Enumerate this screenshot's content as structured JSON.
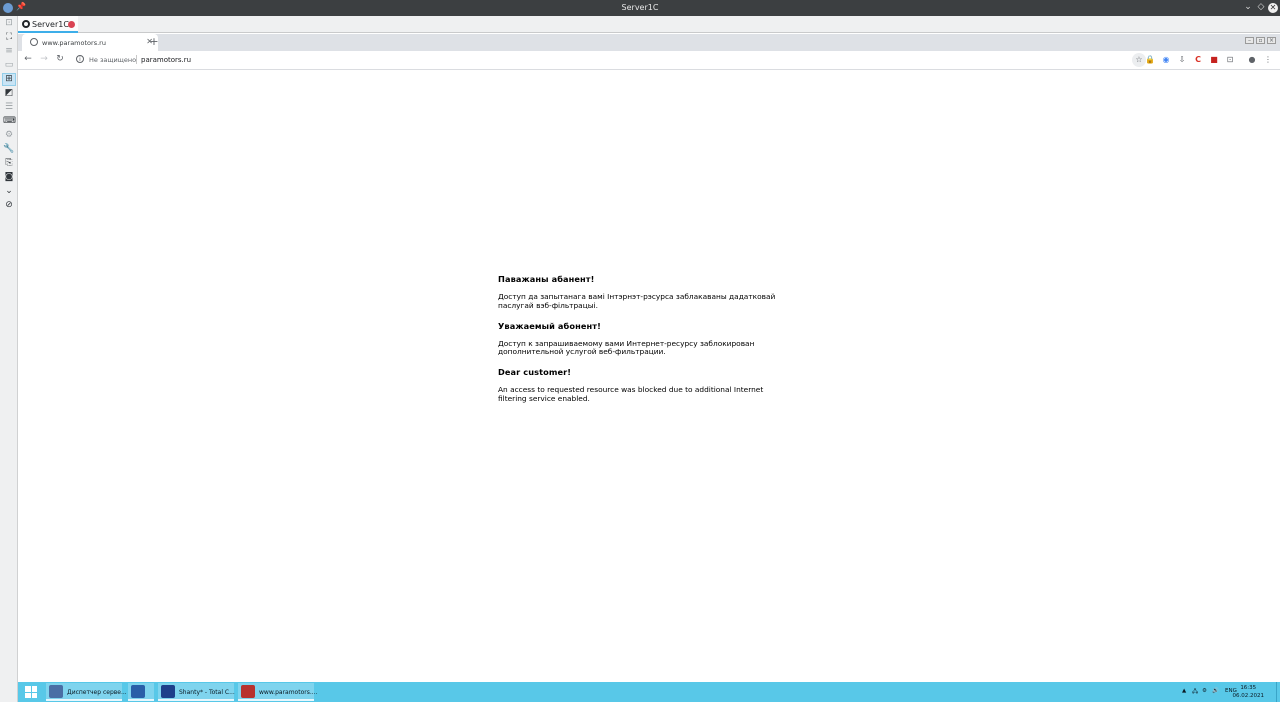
{
  "remote_window": {
    "title": "Server1C",
    "session_tab": {
      "label": "Server1C"
    }
  },
  "left_toolbar": {
    "tools": [
      {
        "icon": "fit-screen-icon",
        "glyph": "⊡",
        "state": "dim"
      },
      {
        "icon": "fullscreen-icon",
        "glyph": "⛶",
        "state": "normal"
      },
      {
        "icon": "menu-icon",
        "glyph": "≡",
        "state": "dim"
      },
      {
        "icon": "window-icon",
        "glyph": "▭",
        "state": "dim"
      },
      {
        "icon": "scale-icon",
        "glyph": "⊞",
        "state": "active"
      },
      {
        "icon": "grab-input-icon",
        "glyph": "◩",
        "state": "normal"
      },
      {
        "icon": "list-icon",
        "glyph": "☰",
        "state": "dim"
      },
      {
        "icon": "keyboard-icon",
        "glyph": "⌨",
        "state": "normal"
      },
      {
        "icon": "settings-icon",
        "glyph": "⚙",
        "state": "dim"
      },
      {
        "icon": "wrench-icon",
        "glyph": "🔧",
        "state": "normal"
      },
      {
        "icon": "clipboard-icon",
        "glyph": "⎘",
        "state": "normal"
      },
      {
        "icon": "screenshot-icon",
        "glyph": "◙",
        "state": "normal"
      },
      {
        "icon": "collapse-icon",
        "glyph": "⌄",
        "state": "normal"
      },
      {
        "icon": "disconnect-icon",
        "glyph": "⊘",
        "state": "normal"
      }
    ]
  },
  "browser": {
    "tab": {
      "title": "www.paramotors.ru"
    },
    "omnibox": {
      "security_label": "Не защищено",
      "url": "paramotors.ru"
    }
  },
  "page": {
    "sections": [
      {
        "heading": "Паважаны абанент!",
        "lines": [
          "Доступ да запытанага вамі Інтэрнэт-рэсурса заблакаваны дадатковай",
          "паслугай вэб-фільтрацыі."
        ]
      },
      {
        "heading": "Уважаемый абонент!",
        "lines": [
          "Доступ к запрашиваемому вами Интернет-ресурсу заблокирован",
          "дополнительной услугой веб-фильтрации."
        ]
      },
      {
        "heading": "Dear customer!",
        "lines": [
          "An access to requested resource was blocked due to additional Internet",
          "filtering service enabled."
        ]
      }
    ]
  },
  "taskbar": {
    "tasks": [
      {
        "label": "Диспетчер серве...",
        "icon": "server-manager-icon",
        "color": "#4a6fa5"
      },
      {
        "label": "",
        "icon": "powershell-icon",
        "color": "#2a5fa8"
      },
      {
        "label": "Shanty* - Total C...",
        "icon": "floppy-disk-icon",
        "color": "#1e3f8a"
      },
      {
        "label": "www.paramotors....",
        "icon": "browser-icon",
        "color": "#b8322e"
      }
    ],
    "tray": {
      "language": "ENG",
      "time": "16:35",
      "date": "06.02.2021"
    }
  },
  "colors": {
    "taskbar": "#58c8e8",
    "accent": "#3daee9",
    "record": "#da4453"
  }
}
